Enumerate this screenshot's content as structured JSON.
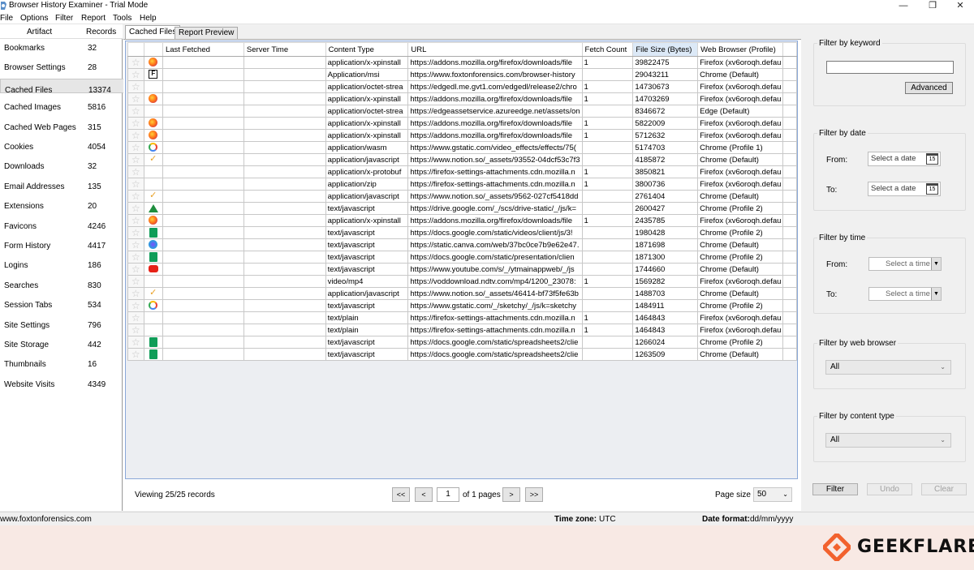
{
  "window": {
    "title": "Browser History Examiner - Trial Mode",
    "controls": [
      "—",
      "❐",
      "✕"
    ]
  },
  "menu": [
    "File",
    "Options",
    "Filter",
    "Report",
    "Tools",
    "Help"
  ],
  "artifacts": {
    "header_artifact": "Artifact",
    "header_records": "Records",
    "items": [
      {
        "name": "Bookmarks",
        "count": "32"
      },
      {
        "name": "Browser Settings",
        "count": "28"
      },
      {
        "name": "Cached Files",
        "count": "13374"
      },
      {
        "name": "Cached Images",
        "count": "5816"
      },
      {
        "name": "Cached Web Pages",
        "count": "315"
      },
      {
        "name": "Cookies",
        "count": "4054"
      },
      {
        "name": "Downloads",
        "count": "32"
      },
      {
        "name": "Email Addresses",
        "count": "135"
      },
      {
        "name": "Extensions",
        "count": "20"
      },
      {
        "name": "Favicons",
        "count": "4246"
      },
      {
        "name": "Form History",
        "count": "4417"
      },
      {
        "name": "Logins",
        "count": "186"
      },
      {
        "name": "Searches",
        "count": "830"
      },
      {
        "name": "Session Tabs",
        "count": "534"
      },
      {
        "name": "Site Settings",
        "count": "796"
      },
      {
        "name": "Site Storage",
        "count": "442"
      },
      {
        "name": "Thumbnails",
        "count": "16"
      },
      {
        "name": "Website Visits",
        "count": "4349"
      }
    ],
    "selected": "Cached Files"
  },
  "tabs": [
    "Cached Files",
    "Report Preview"
  ],
  "table": {
    "columns": [
      "Last Fetched",
      "Server Time",
      "Content Type",
      "URL",
      "Fetch Count",
      "File Size (Bytes)",
      "Web Browser (Profile)"
    ],
    "rows": [
      {
        "icon": "firefox-icon",
        "content_type": "application/x-xpinstall",
        "url": "https://addons.mozilla.org/firefox/downloads/file",
        "fetch": "1",
        "size": "39822475",
        "browser": "Firefox (xv6oroqh.defau"
      },
      {
        "icon": "foxton-icon",
        "content_type": "Application/msi",
        "url": "https://www.foxtonforensics.com/browser-history",
        "fetch": "",
        "size": "29043211",
        "browser": "Chrome (Default)"
      },
      {
        "icon": "",
        "content_type": "application/octet-strea",
        "url": "https://edgedl.me.gvt1.com/edgedl/release2/chro",
        "fetch": "1",
        "size": "14730673",
        "browser": "Firefox (xv6oroqh.defau"
      },
      {
        "icon": "firefox-icon",
        "content_type": "application/x-xpinstall",
        "url": "https://addons.mozilla.org/firefox/downloads/file",
        "fetch": "1",
        "size": "14703269",
        "browser": "Firefox (xv6oroqh.defau"
      },
      {
        "icon": "",
        "content_type": "application/octet-strea",
        "url": "https://edgeassetservice.azureedge.net/assets/on",
        "fetch": "",
        "size": "8346672",
        "browser": "Edge (Default)"
      },
      {
        "icon": "firefox-icon",
        "content_type": "application/x-xpinstall",
        "url": "https://addons.mozilla.org/firefox/downloads/file",
        "fetch": "1",
        "size": "5822009",
        "browser": "Firefox (xv6oroqh.defau"
      },
      {
        "icon": "firefox-icon",
        "content_type": "application/x-xpinstall",
        "url": "https://addons.mozilla.org/firefox/downloads/file",
        "fetch": "1",
        "size": "5712632",
        "browser": "Firefox (xv6oroqh.defau"
      },
      {
        "icon": "google-icon",
        "content_type": "application/wasm",
        "url": "https://www.gstatic.com/video_effects/effects/75(",
        "fetch": "",
        "size": "5174703",
        "browser": "Chrome (Profile 1)"
      },
      {
        "icon": "notion-check-icon",
        "content_type": "application/javascript",
        "url": "https://www.notion.so/_assets/93552-04dcf53c7f3",
        "fetch": "",
        "size": "4185872",
        "browser": "Chrome (Default)"
      },
      {
        "icon": "",
        "content_type": "application/x-protobuf",
        "url": "https://firefox-settings-attachments.cdn.mozilla.n",
        "fetch": "1",
        "size": "3850821",
        "browser": "Firefox (xv6oroqh.defau"
      },
      {
        "icon": "",
        "content_type": "application/zip",
        "url": "https://firefox-settings-attachments.cdn.mozilla.n",
        "fetch": "1",
        "size": "3800736",
        "browser": "Firefox (xv6oroqh.defau"
      },
      {
        "icon": "notion-check-icon",
        "content_type": "application/javascript",
        "url": "https://www.notion.so/_assets/9562-027cf5418dd",
        "fetch": "",
        "size": "2761404",
        "browser": "Chrome (Default)"
      },
      {
        "icon": "drive-icon",
        "content_type": "text/javascript",
        "url": "https://drive.google.com/_/scs/drive-static/_/js/k=",
        "fetch": "",
        "size": "2600427",
        "browser": "Chrome (Profile 2)"
      },
      {
        "icon": "firefox-icon",
        "content_type": "application/x-xpinstall",
        "url": "https://addons.mozilla.org/firefox/downloads/file",
        "fetch": "1",
        "size": "2435785",
        "browser": "Firefox (xv6oroqh.defau"
      },
      {
        "icon": "sheets-icon",
        "content_type": "text/javascript",
        "url": "https://docs.google.com/static/videos/client/js/3!",
        "fetch": "",
        "size": "1980428",
        "browser": "Chrome (Profile 2)"
      },
      {
        "icon": "canva-icon",
        "content_type": "text/javascript",
        "url": "https://static.canva.com/web/37bc0ce7b9e62e47.",
        "fetch": "",
        "size": "1871698",
        "browser": "Chrome (Default)"
      },
      {
        "icon": "sheets-icon",
        "content_type": "text/javascript",
        "url": "https://docs.google.com/static/presentation/clien",
        "fetch": "",
        "size": "1871300",
        "browser": "Chrome (Profile 2)"
      },
      {
        "icon": "youtube-icon",
        "content_type": "text/javascript",
        "url": "https://www.youtube.com/s/_/ytmainappweb/_/js",
        "fetch": "",
        "size": "1744660",
        "browser": "Chrome (Default)"
      },
      {
        "icon": "",
        "content_type": "video/mp4",
        "url": "https://voddownload.ndtv.com/mp4/1200_23078:",
        "fetch": "1",
        "size": "1569282",
        "browser": "Firefox (xv6oroqh.defau"
      },
      {
        "icon": "notion-check-icon",
        "content_type": "application/javascript",
        "url": "https://www.notion.so/_assets/46414-bf73f5fe63b",
        "fetch": "",
        "size": "1488703",
        "browser": "Chrome (Default)"
      },
      {
        "icon": "google-icon",
        "content_type": "text/javascript",
        "url": "https://www.gstatic.com/_/sketchy/_/js/k=sketchy",
        "fetch": "",
        "size": "1484911",
        "browser": "Chrome (Profile 2)"
      },
      {
        "icon": "",
        "content_type": "text/plain",
        "url": "https://firefox-settings-attachments.cdn.mozilla.n",
        "fetch": "1",
        "size": "1464843",
        "browser": "Firefox (xv6oroqh.defau"
      },
      {
        "icon": "",
        "content_type": "text/plain",
        "url": "https://firefox-settings-attachments.cdn.mozilla.n",
        "fetch": "1",
        "size": "1464843",
        "browser": "Firefox (xv6oroqh.defau"
      },
      {
        "icon": "sheets-icon",
        "content_type": "text/javascript",
        "url": "https://docs.google.com/static/spreadsheets2/clie",
        "fetch": "",
        "size": "1266024",
        "browser": "Chrome (Profile 2)"
      },
      {
        "icon": "sheets-icon",
        "content_type": "text/javascript",
        "url": "https://docs.google.com/static/spreadsheets2/clie",
        "fetch": "",
        "size": "1263509",
        "browser": "Chrome (Default)"
      }
    ]
  },
  "pager": {
    "viewing": "Viewing 25/25 records",
    "first": "<<",
    "prev": "<",
    "page": "1",
    "of_pages": "of 1 pages",
    "next": ">",
    "last": ">>",
    "page_size_label": "Page size",
    "page_size": "50"
  },
  "status": {
    "site": "www.foxtonforensics.com",
    "tz_label": "Time zone:",
    "tz_value": "UTC",
    "df_label": "Date format:",
    "df_value": "dd/mm/yyyy"
  },
  "filters": {
    "keyword_title": "Filter by keyword",
    "keyword_value": "",
    "advanced": "Advanced",
    "date_title": "Filter by date",
    "date_from_label": "From:",
    "date_to_label": "To:",
    "date_placeholder": "Select a date",
    "cal_num": "15",
    "time_title": "Filter by time",
    "time_from_label": "From:",
    "time_to_label": "To:",
    "time_placeholder": "Select a time",
    "browser_title": "Filter by web browser",
    "browser_value": "All",
    "content_title": "Filter by content type",
    "content_value": "All",
    "filter_btn": "Filter",
    "undo_btn": "Undo",
    "clear_btn": "Clear"
  },
  "brand": {
    "name": "GEEKFLARE",
    "color": "#f2622e"
  }
}
